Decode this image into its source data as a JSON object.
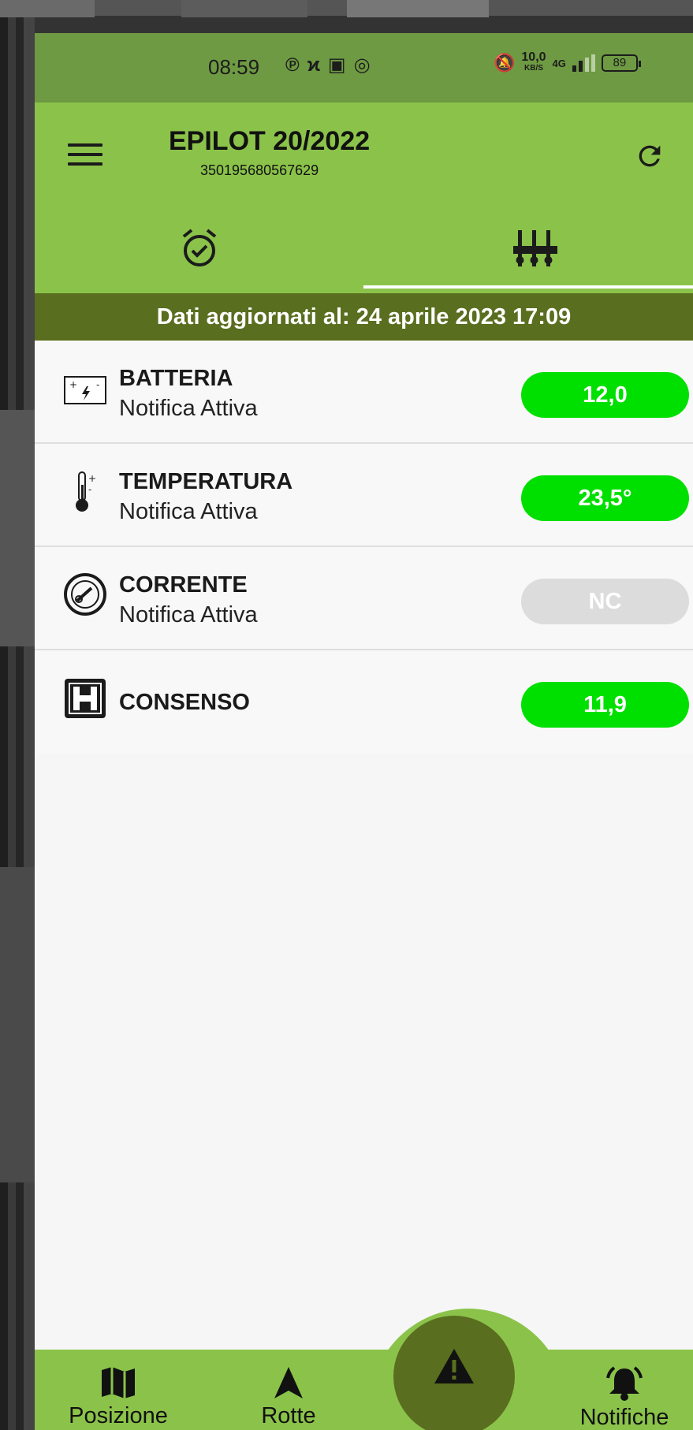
{
  "status_bar": {
    "time": "08:59",
    "notification_icons": [
      "pinterest-icon",
      "nfc-icon",
      "app-icon",
      "instagram-icon"
    ],
    "network_speed": "10,0",
    "network_unit": "KB/S",
    "network_type": "4G",
    "battery": "89"
  },
  "app_bar": {
    "title": "EPILOT 20/2022",
    "subtitle": "350195680567629"
  },
  "tabs": [
    {
      "icon": "alarm-check-icon",
      "selected": false
    },
    {
      "icon": "sliders-icon",
      "selected": true
    }
  ],
  "updated_banner": "Dati aggiornati al: 24 aprile 2023 17:09",
  "sensors": [
    {
      "name": "BATTERIA",
      "status": "Notifica Attiva",
      "value": "12,0",
      "icon": "battery-icon",
      "connected": true
    },
    {
      "name": "TEMPERATURA",
      "status": "Notifica Attiva",
      "value": "23,5°",
      "icon": "thermometer-icon",
      "connected": true
    },
    {
      "name": "CORRENTE",
      "status": "Notifica Attiva",
      "value": "NC",
      "icon": "gauge-icon",
      "connected": false
    },
    {
      "name": "CONSENSO",
      "status": "",
      "value": "11,9",
      "icon": "h-icon",
      "connected": true
    }
  ],
  "bottom_nav": {
    "position": "Posizione",
    "routes": "Rotte",
    "notifications": "Notifiche"
  },
  "colors": {
    "app_green": "#8bc34a",
    "dark_green": "#5a6e1f",
    "status_green": "#00e000",
    "nc_gray": "#dcdcdc"
  }
}
